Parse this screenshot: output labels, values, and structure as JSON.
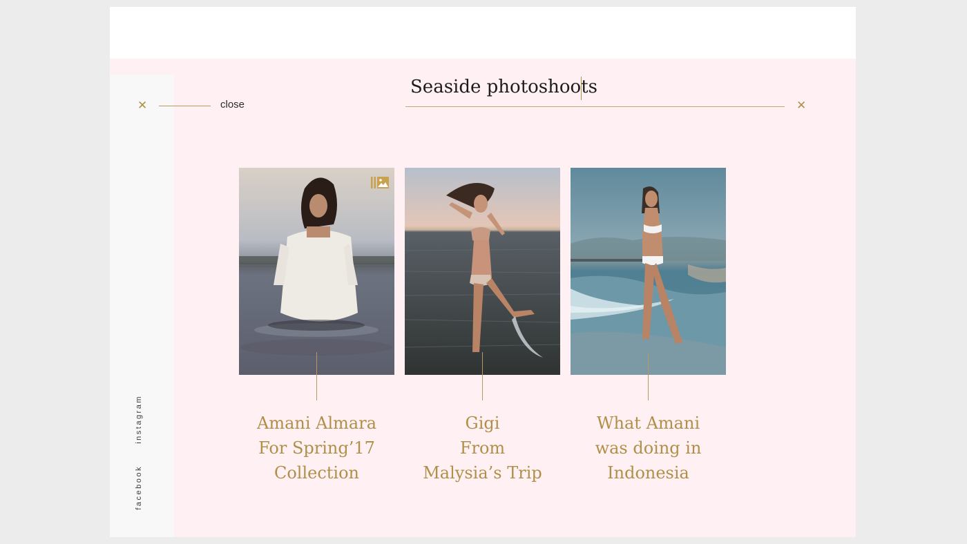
{
  "search": {
    "value": "Seaside photoshoots",
    "clear_icon": "close-icon"
  },
  "close": {
    "label": "close",
    "icon": "close-icon"
  },
  "social": {
    "instagram": "instagram",
    "facebook": "facebook"
  },
  "results": [
    {
      "title": "Amani Almara\nFor Spring’17\nCollection",
      "badge_icon": "gallery-icon",
      "photo": "woman in white dress kneeling in sea water"
    },
    {
      "title": "Gigi\nFrom\nMalysia’s Trip",
      "photo": "woman jumping in ocean waves at dusk"
    },
    {
      "title": "What Amani\nwas doing in\nIndonesia",
      "photo": "woman in white bikini walking on beach"
    }
  ],
  "colors": {
    "accent": "#b08f48",
    "pink_background": "#fff0f4",
    "sidebar": "#f8f8f8",
    "outer": "#ececec"
  }
}
